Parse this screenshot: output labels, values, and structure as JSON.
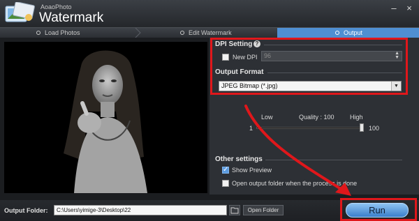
{
  "app": {
    "brand": "AoaoPhoto",
    "title": "Watermark",
    "minimize_glyph": "–",
    "close_glyph": "×"
  },
  "steps": [
    {
      "label": "Load Photos",
      "active": false
    },
    {
      "label": "Edit Watermark",
      "active": false
    },
    {
      "label": "Output",
      "active": true
    }
  ],
  "dpi_setting": {
    "title": "DPI Setting",
    "help_glyph": "?",
    "new_dpi_label": "New DPI",
    "new_dpi_checked": false,
    "dpi_value": "96"
  },
  "output_format": {
    "title": "Output Format",
    "selected": "JPEG Bitmap (*.jpg)"
  },
  "quality": {
    "low_label": "Low",
    "high_label": "High",
    "quality_text": "Quality : 100",
    "min": "1",
    "max": "100",
    "value": 100
  },
  "other_settings": {
    "title": "Other settings",
    "show_preview_label": "Show Preview",
    "show_preview_checked": true,
    "open_folder_label": "Open output folder when the process is done",
    "open_folder_checked": false
  },
  "footer": {
    "output_folder_label": "Output Folder:",
    "output_folder_path": "C:\\Users\\yimige-3\\Desktop\\22",
    "open_folder_button": "Open Folder",
    "run_button": "Run"
  },
  "colors": {
    "accent": "#4f8fd2",
    "annotation": "#e0171b"
  },
  "icons": {
    "app": "app-logo-icon",
    "help": "help-icon",
    "folder": "folder-browse-icon",
    "dropdown": "chevron-down-icon"
  }
}
